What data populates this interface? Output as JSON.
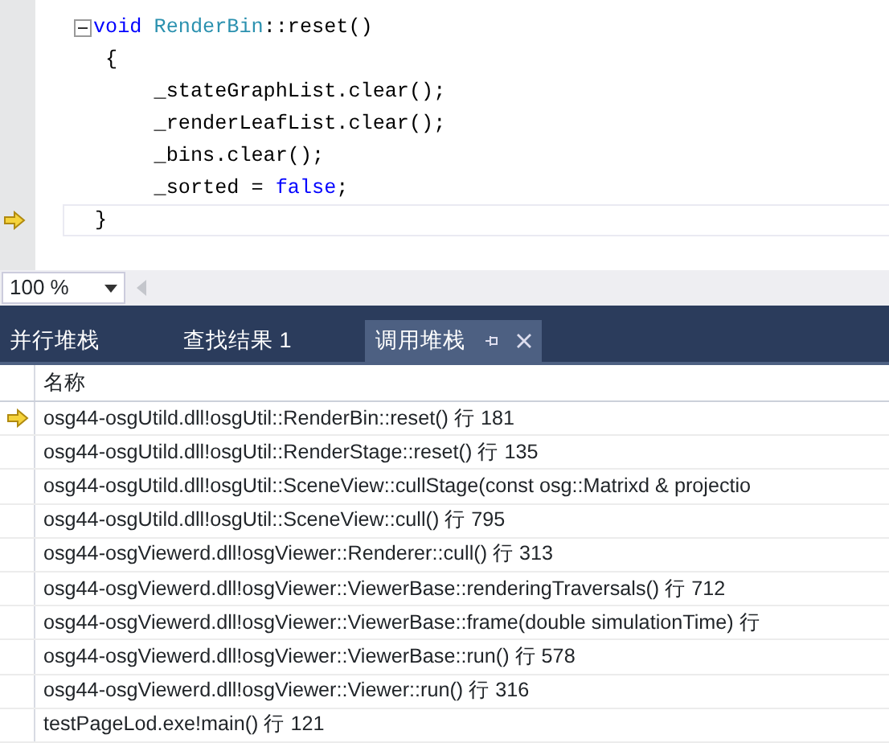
{
  "editor": {
    "lines": [
      {
        "current": false,
        "fold": true,
        "tokens": [
          {
            "text": "void",
            "kind": "keyword"
          },
          {
            "text": " RenderBin",
            "kind": "type"
          },
          {
            "text": "::reset()",
            "kind": "plain"
          }
        ]
      },
      {
        "current": false,
        "fold": false,
        "tokens": [
          {
            "text": " {",
            "kind": "plain"
          }
        ]
      },
      {
        "current": false,
        "fold": false,
        "tokens": [
          {
            "text": "     _stateGraphList.clear();",
            "kind": "plain"
          }
        ]
      },
      {
        "current": false,
        "fold": false,
        "tokens": [
          {
            "text": "     _renderLeafList.clear();",
            "kind": "plain"
          }
        ]
      },
      {
        "current": false,
        "fold": false,
        "tokens": [
          {
            "text": "     _bins.clear();",
            "kind": "plain"
          }
        ]
      },
      {
        "current": false,
        "fold": false,
        "tokens": [
          {
            "text": "     _sorted = ",
            "kind": "plain"
          },
          {
            "text": "false",
            "kind": "keyword"
          },
          {
            "text": ";",
            "kind": "plain"
          }
        ]
      },
      {
        "current": true,
        "fold": false,
        "tokens": [
          {
            "text": "}",
            "kind": "plain"
          }
        ]
      }
    ]
  },
  "zoom": {
    "value": "100 %"
  },
  "tabs": [
    {
      "label": "并行堆栈",
      "selected": false
    },
    {
      "label": "查找结果 1",
      "selected": false
    },
    {
      "label": "调用堆栈",
      "selected": true
    }
  ],
  "call_stack": {
    "columns": [
      "名称"
    ],
    "rows": [
      {
        "text": "osg44-osgUtild.dll!osgUtil::RenderBin::reset() 行 181",
        "current": true
      },
      {
        "text": "osg44-osgUtild.dll!osgUtil::RenderStage::reset() 行 135",
        "current": false
      },
      {
        "text": "osg44-osgUtild.dll!osgUtil::SceneView::cullStage(const osg::Matrixd & projectio",
        "current": false
      },
      {
        "text": "osg44-osgUtild.dll!osgUtil::SceneView::cull() 行 795",
        "current": false
      },
      {
        "text": "osg44-osgViewerd.dll!osgViewer::Renderer::cull() 行 313",
        "current": false
      },
      {
        "text": "osg44-osgViewerd.dll!osgViewer::ViewerBase::renderingTraversals() 行 712",
        "current": false
      },
      {
        "text": "osg44-osgViewerd.dll!osgViewer::ViewerBase::frame(double simulationTime) 行",
        "current": false
      },
      {
        "text": "osg44-osgViewerd.dll!osgViewer::ViewerBase::run() 行 578",
        "current": false
      },
      {
        "text": "osg44-osgViewerd.dll!osgViewer::Viewer::run() 行 316",
        "current": false
      },
      {
        "text": "testPageLod.exe!main() 行 121",
        "current": false
      }
    ]
  }
}
